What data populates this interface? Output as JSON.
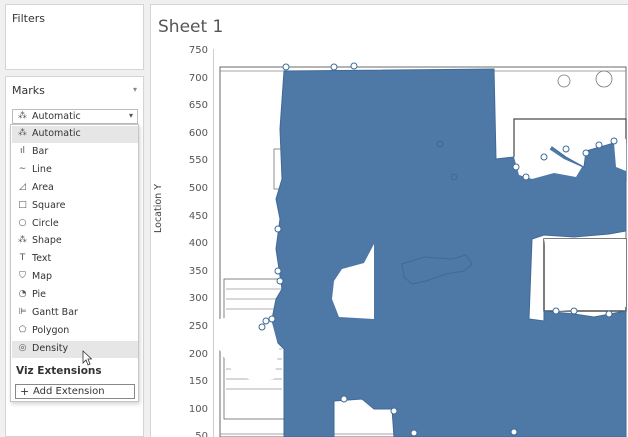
{
  "filters": {
    "title": "Filters"
  },
  "marks": {
    "title": "Marks",
    "collapse_icon": "chevron-down-icon",
    "selected_type": "Automatic",
    "dropdown_items": [
      {
        "label": "Automatic",
        "icon": "auto-icon",
        "glyph": "⁂"
      },
      {
        "label": "Bar",
        "icon": "bar-icon",
        "glyph": "ıl"
      },
      {
        "label": "Line",
        "icon": "line-icon",
        "glyph": "∼"
      },
      {
        "label": "Area",
        "icon": "area-icon",
        "glyph": "◿"
      },
      {
        "label": "Square",
        "icon": "square-icon",
        "glyph": "□"
      },
      {
        "label": "Circle",
        "icon": "circle-icon",
        "glyph": "○"
      },
      {
        "label": "Shape",
        "icon": "shape-icon",
        "glyph": "⁂"
      },
      {
        "label": "Text",
        "icon": "text-icon",
        "glyph": "T"
      },
      {
        "label": "Map",
        "icon": "map-icon",
        "glyph": "⛉"
      },
      {
        "label": "Pie",
        "icon": "pie-icon",
        "glyph": "◔"
      },
      {
        "label": "Gantt Bar",
        "icon": "gantt-icon",
        "glyph": "⊫"
      },
      {
        "label": "Polygon",
        "icon": "polygon-icon",
        "glyph": "⬠"
      },
      {
        "label": "Density",
        "icon": "density-icon",
        "glyph": "◎"
      }
    ],
    "viz_extensions_label": "Viz Extensions",
    "add_extension_label": "Add Extension"
  },
  "sheet": {
    "title": "Sheet 1",
    "y_axis_label": "Location Y",
    "y_ticks": [
      "750",
      "700",
      "650",
      "600",
      "550",
      "500",
      "450",
      "400",
      "350",
      "300",
      "250",
      "200",
      "150",
      "100",
      "50"
    ]
  },
  "colors": {
    "mark": "#4e79a7",
    "highlight": "#e6e6e6"
  }
}
